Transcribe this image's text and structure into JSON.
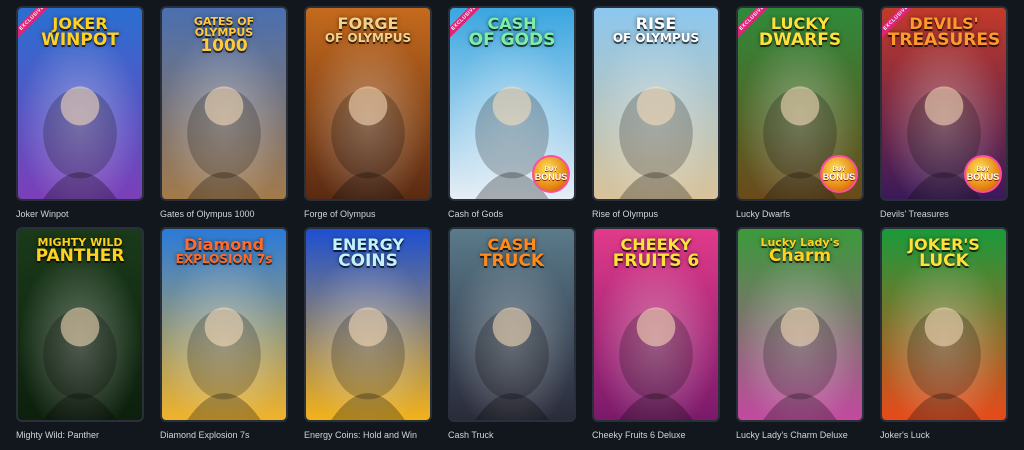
{
  "games": [
    {
      "title": "Joker Winpot",
      "logo": [
        "JOKER",
        "WINPOT"
      ],
      "exclusive": "EXCLUSIVE",
      "bonus": null,
      "bg": [
        "#2a6fd1",
        "#7b3fb8"
      ],
      "logo_color": "#ffd21f"
    },
    {
      "title": "Gates of Olympus 1000",
      "logo": [
        "GATES OF OLYMPUS",
        "1000"
      ],
      "exclusive": null,
      "bonus": null,
      "bg": [
        "#4a6fb0",
        "#a37a4a"
      ],
      "logo_color": "#ffc93d"
    },
    {
      "title": "Forge of Olympus",
      "logo": [
        "FORGE",
        "OF OLYMPUS"
      ],
      "exclusive": null,
      "bonus": null,
      "bg": [
        "#c46a1d",
        "#5a2a12"
      ],
      "logo_color": "#f2d28a"
    },
    {
      "title": "Cash of Gods",
      "logo": [
        "CASH",
        "OF GODS"
      ],
      "exclusive": "EXCLUSIVE",
      "bonus": [
        "BUY",
        "BONUS"
      ],
      "bg": [
        "#3aa6e0",
        "#e6eef5"
      ],
      "logo_color": "#7af0a0"
    },
    {
      "title": "Rise of Olympus",
      "logo": [
        "RISE",
        "OF OLYMPUS"
      ],
      "exclusive": null,
      "bonus": null,
      "bg": [
        "#8cc7ef",
        "#d9c39a"
      ],
      "logo_color": "#ffffff"
    },
    {
      "title": "Lucky Dwarfs",
      "logo": [
        "LUCKY",
        "DWARFS"
      ],
      "exclusive": "EXCLUSIVE",
      "bonus": [
        "BUY",
        "BONUS"
      ],
      "bg": [
        "#2f8a3a",
        "#6b4a1a"
      ],
      "logo_color": "#ffe13a"
    },
    {
      "title": "Devils' Treasures",
      "logo": [
        "DEVILS'",
        "TREASURES"
      ],
      "exclusive": "EXCLUSIVE",
      "bonus": [
        "BUY",
        "BONUS"
      ],
      "bg": [
        "#c23a2a",
        "#3a1a5a"
      ],
      "logo_color": "#ff9a2a"
    },
    {
      "title": "Mighty Wild: Panther",
      "logo": [
        "MIGHTY WILD",
        "PANTHER"
      ],
      "exclusive": null,
      "bonus": null,
      "bg": [
        "#1a3a1a",
        "#0d1f0d"
      ],
      "logo_color": "#ffd21f"
    },
    {
      "title": "Diamond Explosion 7s",
      "logo": [
        "Diamond",
        "EXPLOSION 7s"
      ],
      "exclusive": null,
      "bonus": null,
      "bg": [
        "#2a7ad9",
        "#f0b32a"
      ],
      "logo_color": "#ff6a2a"
    },
    {
      "title": "Energy Coins: Hold and Win",
      "logo": [
        "ENERGY",
        "COINS"
      ],
      "exclusive": null,
      "bonus": null,
      "bg": [
        "#1d4fd1",
        "#f2b21a"
      ],
      "logo_color": "#bff3ff"
    },
    {
      "title": "Cash Truck",
      "logo": [
        "CASH",
        "TRUCK"
      ],
      "exclusive": null,
      "bonus": null,
      "bg": [
        "#5a7a8a",
        "#2a2a3a"
      ],
      "logo_color": "#ff8a1a"
    },
    {
      "title": "Cheeky Fruits 6 Deluxe",
      "logo": [
        "CHEEKY",
        "FRUITS 6"
      ],
      "exclusive": null,
      "bonus": null,
      "bg": [
        "#e23a8a",
        "#7a1a6a"
      ],
      "logo_color": "#ffe13a"
    },
    {
      "title": "Lucky Lady's Charm Deluxe",
      "logo": [
        "Lucky Lady's",
        "Charm"
      ],
      "exclusive": null,
      "bonus": null,
      "bg": [
        "#3a9a3a",
        "#c24aa0"
      ],
      "logo_color": "#ffd21f"
    },
    {
      "title": "Joker's Luck",
      "logo": [
        "JOKER'S",
        "LUCK"
      ],
      "exclusive": null,
      "bonus": null,
      "bg": [
        "#1a9a3a",
        "#e84a1a"
      ],
      "logo_color": "#ffe13a"
    }
  ]
}
